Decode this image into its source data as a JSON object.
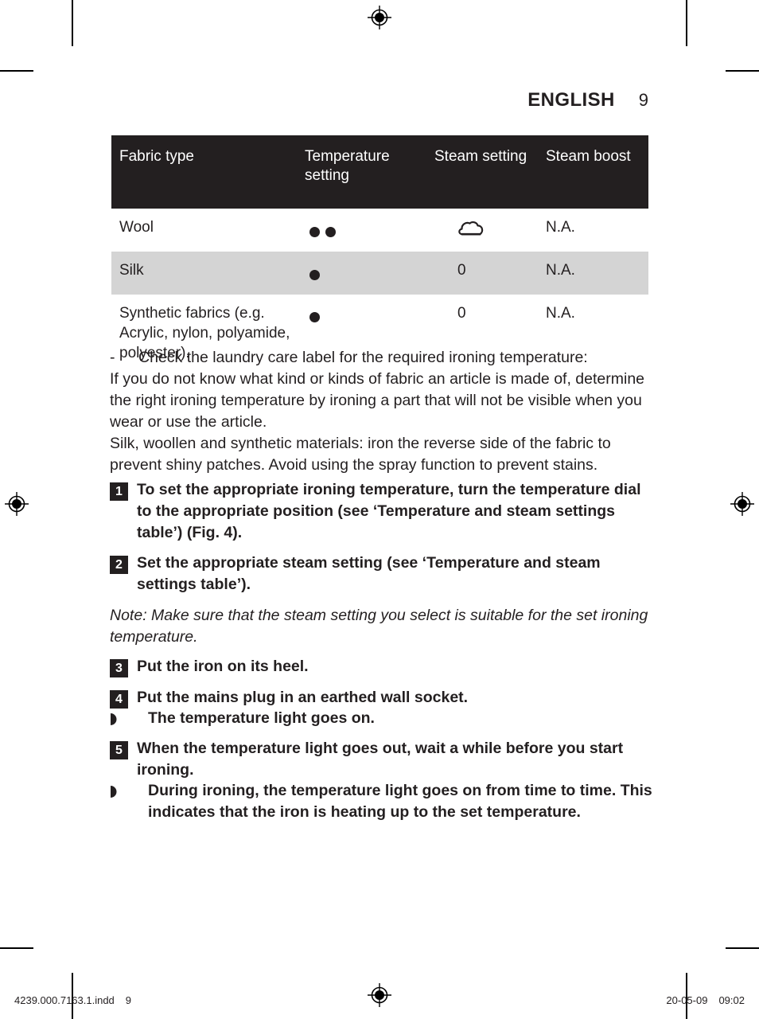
{
  "header": {
    "language": "ENGLISH",
    "page_number": "9"
  },
  "table": {
    "columns": [
      "Fabric type",
      "Temperature setting",
      "Steam setting",
      "Steam boost"
    ],
    "rows": [
      {
        "fabric": "Wool",
        "temperature_dots": 2,
        "steam": "steam-cloud-icon",
        "steam_boost": "N.A.",
        "shaded": false
      },
      {
        "fabric": "Silk",
        "temperature_dots": 1,
        "steam": "0",
        "steam_boost": "N.A.",
        "shaded": true
      },
      {
        "fabric": "Synthetic fabrics (e.g. Acrylic, nylon, polyamide, polyester).",
        "temperature_dots": 1,
        "steam": "0",
        "steam_boost": "N.A.",
        "shaded": false
      }
    ]
  },
  "body": {
    "dash_item": "Check the laundry care label for the required ironing temperature:",
    "paragraph1": "If you do not know what kind or kinds of fabric an article is made of, determine the right ironing temperature by ironing a part that will not be visible when you wear or use the article.",
    "paragraph2": "Silk, woollen and synthetic materials: iron the reverse side of the fabric to prevent shiny patches. Avoid using the spray function to prevent stains."
  },
  "steps": {
    "step1_num": "1",
    "step1_text": "To set the appropriate ironing temperature, turn the temperature dial to the appropriate position (see ‘Temperature and steam settings table’) (Fig. 4).",
    "step2_num": "2",
    "step2_text": "Set the appropriate steam setting  (see ‘Temperature and steam settings table’).",
    "step3_num": "3",
    "step3_text": "Put the iron on its heel.",
    "step4_num": "4",
    "step4_text": "Put the mains plug in an earthed wall socket.",
    "step5_num": "5",
    "step5_text": "When the temperature light goes out, wait a while before you start ironing."
  },
  "note": {
    "text": "Note: Make sure that the steam setting you select is suitable for the set ironing temperature."
  },
  "bullets": {
    "bullet1": "The temperature light goes on.",
    "bullet2": "During ironing, the temperature light goes on from time to time. This indicates that the iron is heating up to the set temperature."
  },
  "footer": {
    "file_name": "4239.000.7163.1.indd",
    "file_page": "9",
    "date": "20-05-09",
    "time": "09:02"
  },
  "colors": {
    "ink": "#231f20",
    "table_header_bg": "#231f20",
    "shaded_row_bg": "#d4d4d4",
    "page_bg": "#ffffff"
  }
}
